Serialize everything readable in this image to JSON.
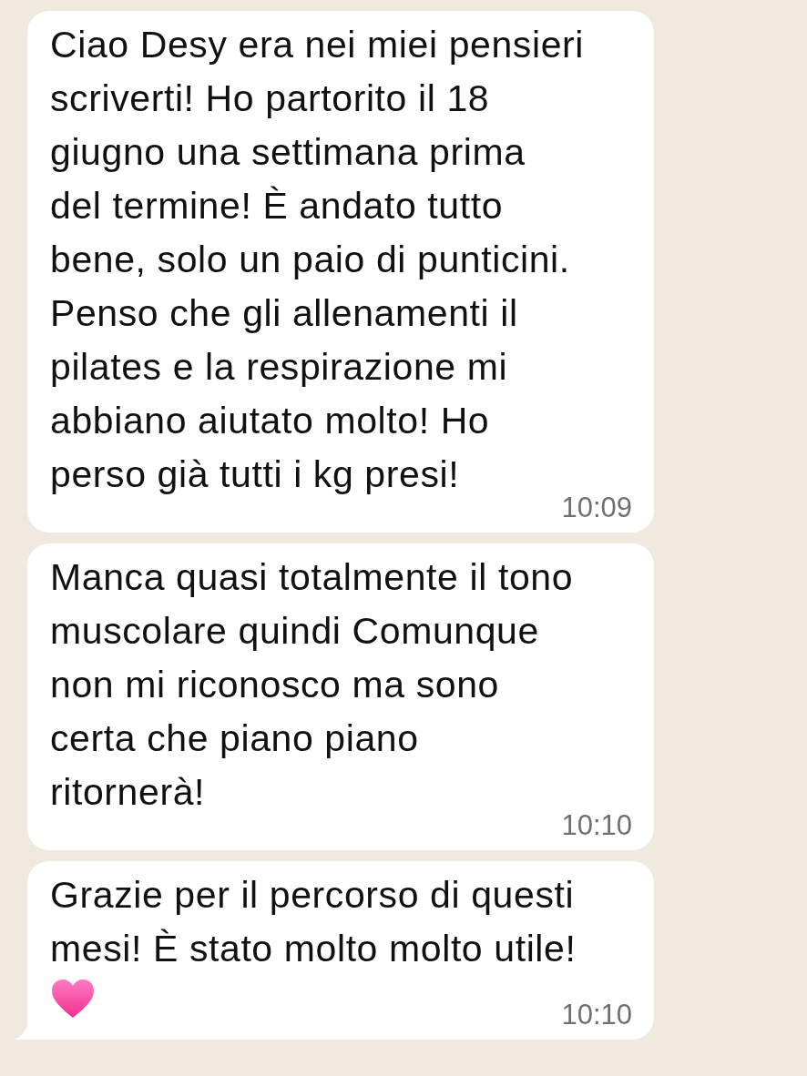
{
  "messages": [
    {
      "text": "Ciao Desy era nei miei pensieri\nscriverti! Ho partorito il 18\ngiugno una settimana prima\ndel termine! È andato tutto\nbene, solo un paio di punticini.\nPenso che gli allenamenti il\npilates e la respirazione mi\nabbiano aiutato molto! Ho\nperso già tutti i kg presi!",
      "time": "10:09"
    },
    {
      "text": "Manca quasi totalmente il tono\nmuscolare quindi Comunque\nnon mi riconosco ma sono\ncerta che piano piano\nritornerà!",
      "time": "10:10"
    },
    {
      "text": "Grazie per il percorso di questi\nmesi! È stato molto molto utile!",
      "heart": true,
      "time": "10:10",
      "tail": true
    }
  ]
}
